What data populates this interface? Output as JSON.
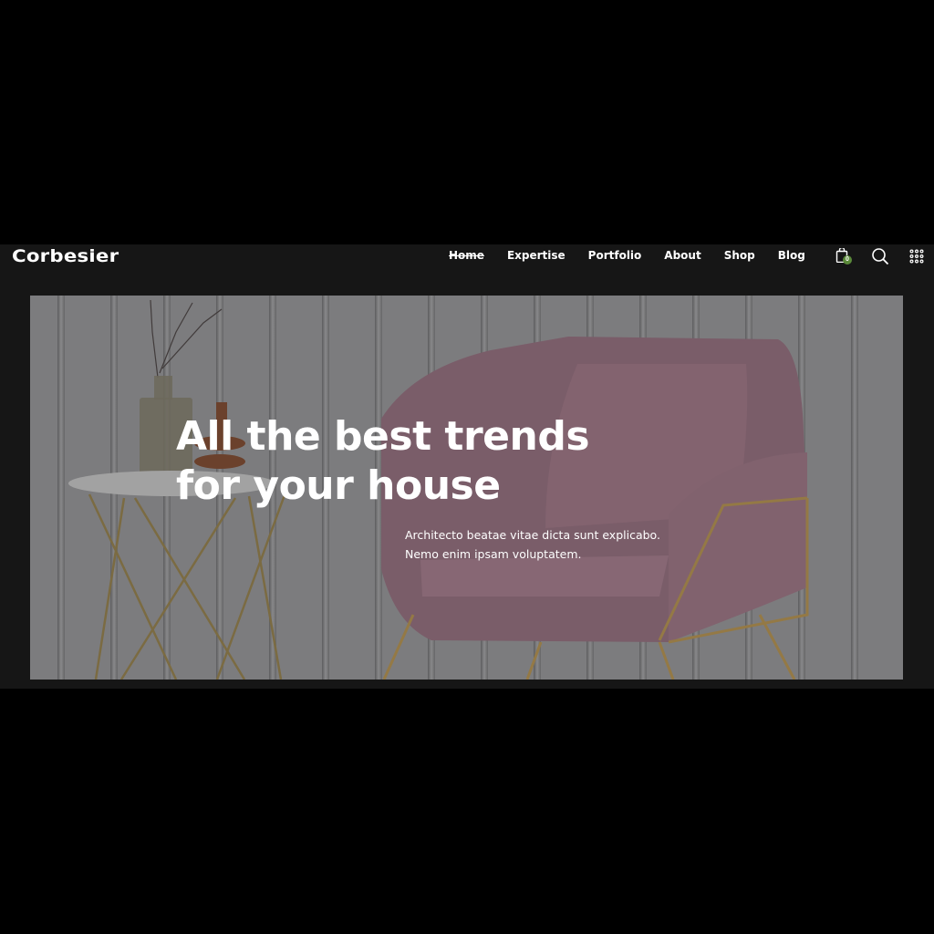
{
  "header": {
    "logo": "Corbesier",
    "nav": [
      {
        "label": "Home",
        "active": true
      },
      {
        "label": "Expertise",
        "active": false
      },
      {
        "label": "Portfolio",
        "active": false
      },
      {
        "label": "About",
        "active": false
      },
      {
        "label": "Shop",
        "active": false
      },
      {
        "label": "Blog",
        "active": false
      }
    ],
    "cart_count": "0",
    "icons": [
      "shopping-bag-icon",
      "search-icon",
      "grid-menu-icon"
    ]
  },
  "hero": {
    "title_line1": "All the best trends",
    "title_line2": "for your house",
    "subtitle_line1": "Architecto beatae vitae dicta sunt explicabo.",
    "subtitle_line2": "Nemo enim ipsam voluptatem."
  },
  "colors": {
    "page_bg": "#161616",
    "badge": "#5b8a3a",
    "chair": "#8e6e7c",
    "gold": "#a98a4f"
  }
}
